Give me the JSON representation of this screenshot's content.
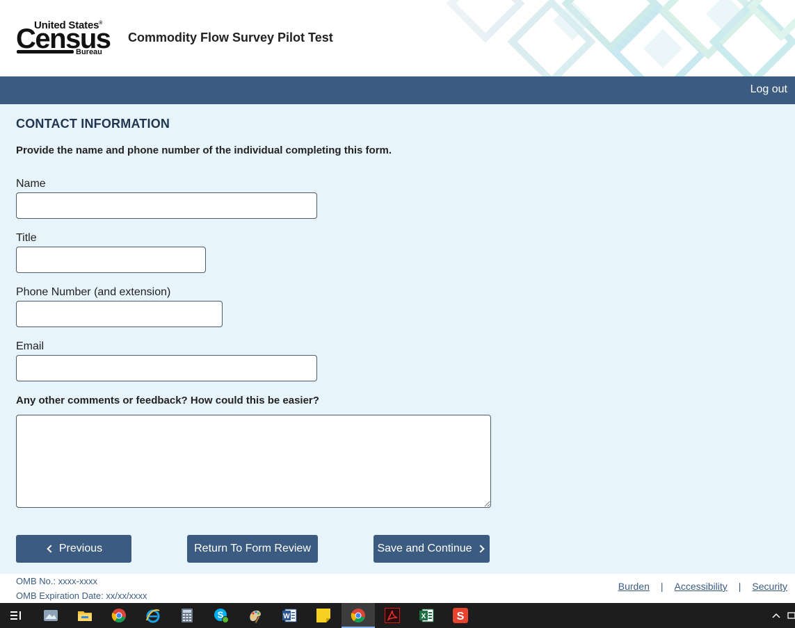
{
  "header": {
    "logo_top": "United States",
    "logo_main": "Census",
    "logo_sub": "Bureau",
    "app_title": "Commodity Flow Survey Pilot Test"
  },
  "nav": {
    "logout_label": "Log out"
  },
  "form": {
    "section_title": "CONTACT INFORMATION",
    "instructions": "Provide the name and phone number of the individual completing this form.",
    "name_label": "Name",
    "name_value": "",
    "title_label": "Title",
    "title_value": "",
    "phone_label": "Phone Number (and extension)",
    "phone_value": "",
    "email_label": "Email",
    "email_value": "",
    "comments_label": "Any other comments or feedback? How could this be easier?",
    "comments_value": ""
  },
  "buttons": {
    "previous": "Previous",
    "return_review": "Return To Form Review",
    "save_continue": "Save and Continue"
  },
  "footer": {
    "omb_no": "OMB No.: xxxx-xxxx",
    "omb_exp": "OMB Expiration Date: xx/xx/xxxx",
    "links": [
      "Burden",
      "Accessibility",
      "Security"
    ],
    "separator": "|"
  },
  "taskbar": {
    "icons": [
      "task-view-icon",
      "photos-icon",
      "file-explorer-icon",
      "chrome-icon",
      "internet-explorer-icon",
      "calculator-icon",
      "skype-icon",
      "paint-icon",
      "word-icon",
      "sticky-notes-icon",
      "chrome-active-icon",
      "acrobat-icon",
      "excel-icon",
      "snagit-icon"
    ]
  },
  "colors": {
    "nav_bg": "#3b5b81",
    "page_bg": "#e8f4fb",
    "button_bg": "#3b5b81"
  }
}
